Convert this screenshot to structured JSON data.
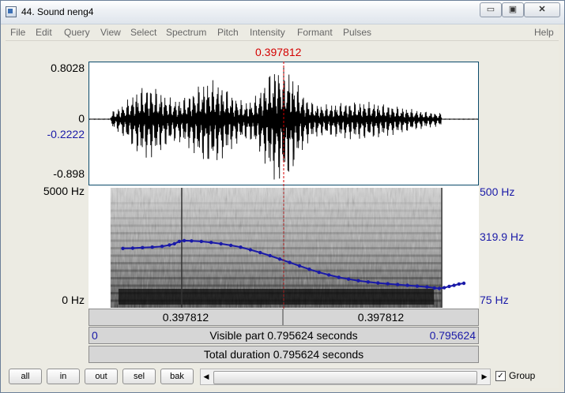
{
  "window": {
    "title": "44. Sound neng4",
    "min_glyph": "▭",
    "max_glyph": "▣",
    "close_glyph": "✕"
  },
  "menu": [
    "File",
    "Edit",
    "Query",
    "View",
    "Select",
    "Spectrum",
    "Pitch",
    "Intensity",
    "Formant",
    "Pulses",
    "Help"
  ],
  "cursor": {
    "time_label": "0.397812",
    "position": 0.5
  },
  "waveform": {
    "ymax": "0.8028",
    "zero": "0",
    "ycursor": "-0.2222",
    "ymin": "-0.898"
  },
  "spectrogram": {
    "fmax": "5000 Hz",
    "fmin": "0 Hz"
  },
  "pitch": {
    "max": "500 Hz",
    "mid": "319.9 Hz",
    "min": "75 Hz",
    "contour_hz": [
      {
        "t": 0.07,
        "hz": 282
      },
      {
        "t": 0.09,
        "hz": 283
      },
      {
        "t": 0.11,
        "hz": 285
      },
      {
        "t": 0.13,
        "hz": 287
      },
      {
        "t": 0.15,
        "hz": 290
      },
      {
        "t": 0.165,
        "hz": 295
      },
      {
        "t": 0.175,
        "hz": 300
      },
      {
        "t": 0.185,
        "hz": 309
      },
      {
        "t": 0.195,
        "hz": 312
      },
      {
        "t": 0.21,
        "hz": 311
      },
      {
        "t": 0.23,
        "hz": 309
      },
      {
        "t": 0.25,
        "hz": 305
      },
      {
        "t": 0.27,
        "hz": 300
      },
      {
        "t": 0.29,
        "hz": 294
      },
      {
        "t": 0.31,
        "hz": 287
      },
      {
        "t": 0.33,
        "hz": 277
      },
      {
        "t": 0.35,
        "hz": 266
      },
      {
        "t": 0.37,
        "hz": 254
      },
      {
        "t": 0.39,
        "hz": 241
      },
      {
        "t": 0.41,
        "hz": 228
      },
      {
        "t": 0.43,
        "hz": 215
      },
      {
        "t": 0.45,
        "hz": 202
      },
      {
        "t": 0.47,
        "hz": 190
      },
      {
        "t": 0.49,
        "hz": 180
      },
      {
        "t": 0.51,
        "hz": 171
      },
      {
        "t": 0.53,
        "hz": 164
      },
      {
        "t": 0.55,
        "hz": 158
      },
      {
        "t": 0.57,
        "hz": 153
      },
      {
        "t": 0.59,
        "hz": 149
      },
      {
        "t": 0.61,
        "hz": 146
      },
      {
        "t": 0.63,
        "hz": 143
      },
      {
        "t": 0.65,
        "hz": 140
      },
      {
        "t": 0.67,
        "hz": 137
      },
      {
        "t": 0.69,
        "hz": 134
      },
      {
        "t": 0.705,
        "hz": 130
      },
      {
        "t": 0.715,
        "hz": 128
      },
      {
        "t": 0.725,
        "hz": 131
      },
      {
        "t": 0.735,
        "hz": 136
      },
      {
        "t": 0.745,
        "hz": 140
      },
      {
        "t": 0.755,
        "hz": 145
      },
      {
        "t": 0.765,
        "hz": 148
      }
    ]
  },
  "selection": {
    "left_part": "0.397812",
    "right_part": "0.397812"
  },
  "visible": {
    "start": "0",
    "label": "Visible part 0.795624 seconds",
    "end": "0.795624"
  },
  "total": {
    "label": "Total duration 0.795624 seconds"
  },
  "buttons": {
    "all": "all",
    "in": "in",
    "out": "out",
    "sel": "sel",
    "bak": "bak"
  },
  "group": {
    "label": "Group",
    "checked": true,
    "check_glyph": "✓"
  },
  "colors": {
    "cursor": "#d40000",
    "pitch": "#1a1aa8",
    "frame": "#0a4a6a"
  }
}
